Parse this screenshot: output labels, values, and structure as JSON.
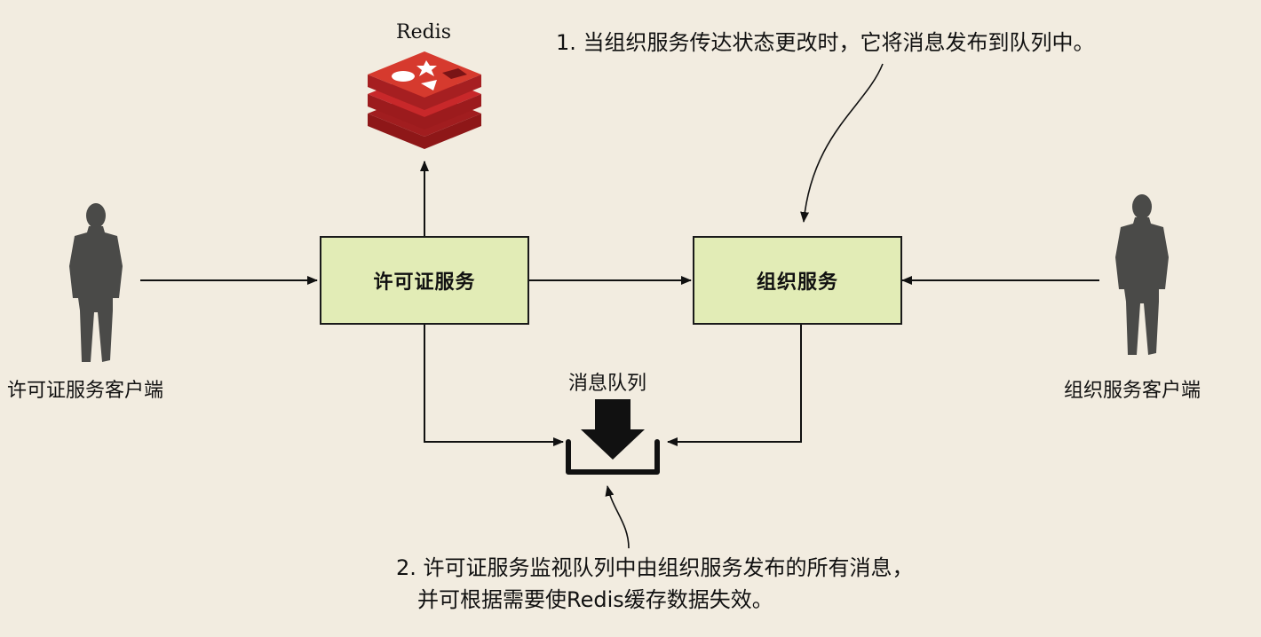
{
  "redis": {
    "label": "Redis",
    "icon": "redis-logo-icon"
  },
  "license_service": {
    "label": "许可证服务"
  },
  "org_service": {
    "label": "组织服务"
  },
  "queue": {
    "label": "消息队列",
    "icon": "message-queue-icon"
  },
  "license_client": {
    "label": "许可证服务客户端",
    "icon": "person-silhouette-icon"
  },
  "org_client": {
    "label": "组织服务客户端",
    "icon": "person-silhouette-icon"
  },
  "notes": {
    "step1": "1. 当组织服务传达状态更改时，它将消息发布到队列中。",
    "step2_line1": "2. 许可证服务监视队列中由组织服务发布的所有消息，",
    "step2_line2": "并可根据需要使Redis缓存数据失效。"
  },
  "colors": {
    "background": "#f2ece0",
    "service_box": "#e2ecb6",
    "redis_red": "#c8282a",
    "person": "#4a4a48"
  }
}
